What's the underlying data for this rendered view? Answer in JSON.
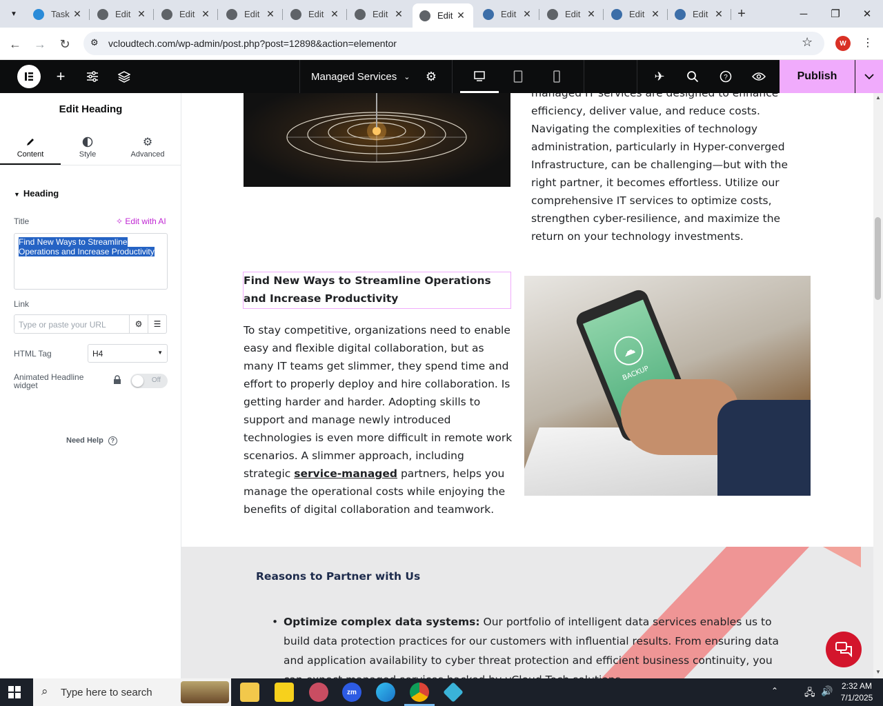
{
  "browser": {
    "tabs": [
      {
        "title": "Task",
        "color": "#2a8bd8"
      },
      {
        "title": "Edit",
        "color": "#5f6368"
      },
      {
        "title": "Edit",
        "color": "#5f6368"
      },
      {
        "title": "Edit",
        "color": "#5f6368"
      },
      {
        "title": "Edit",
        "color": "#5f6368"
      },
      {
        "title": "Edit",
        "color": "#5f6368"
      },
      {
        "title": "Edit",
        "color": "#5f6368"
      },
      {
        "title": "Edit",
        "color": "#3c6ea8"
      },
      {
        "title": "Edit",
        "color": "#5f6368"
      },
      {
        "title": "Edit",
        "color": "#3c6ea8"
      },
      {
        "title": "Edit",
        "color": "#3c6ea8"
      }
    ],
    "url": "vcloudtech.com/wp-admin/post.php?post=12898&action=elementor",
    "profile_initial": "W"
  },
  "editor": {
    "page_name": "Managed Services",
    "publish_label": "Publish"
  },
  "panel": {
    "title": "Edit Heading",
    "tabs": [
      "Content",
      "Style",
      "Advanced"
    ],
    "section": "Heading",
    "title_label": "Title",
    "edit_ai": "Edit with AI",
    "title_value": "Find New Ways to Streamline Operations and Increase Productivity",
    "link_label": "Link",
    "link_placeholder": "Type or paste your URL",
    "html_tag_label": "HTML Tag",
    "html_tag_value": "H4",
    "animated_label": "Animated Headline widget",
    "toggle_state": "Off",
    "help": "Need Help"
  },
  "canvas": {
    "top_text": "managed IT services are designed to enhance efficiency, deliver value, and reduce costs. Navigating the complexities of technology administration, particularly in Hyper-converged Infrastructure, can be challenging—but with the right partner, it becomes effortless. Utilize our comprehensive IT services to optimize costs, strengthen cyber-resilience, and maximize the return on your technology investments.",
    "heading": "Find New Ways to Streamline Operations and Increase Productivity",
    "para_before": "To stay competitive, organizations need to enable easy and flexible digital collaboration, but as many IT teams get slimmer, they spend time and effort to properly deploy and hire collaboration. Is getting harder and harder. Adopting skills to support and manage newly introduced technologies is even more difficult in remote work scenarios. A slimmer approach, including strategic",
    "para_link": "service-managed",
    "para_after": "partners, helps you manage the operational costs while enjoying the benefits of digital collaboration and teamwork.",
    "phone_label": "BACKUP",
    "band_heading": "Reasons to Partner with Us",
    "band_item_bold": "Optimize complex data systems:",
    "band_item_text": "Our portfolio of intelligent data services enables us to build data protection practices for our customers with influential results. From ensuring data and application availability to cyber threat protection and efficient business continuity, you can expect managed services backed by vCloud Tech solutions."
  },
  "taskbar": {
    "search_placeholder": "Type here to search",
    "time": "2:32 AM",
    "date": "7/1/2025"
  }
}
